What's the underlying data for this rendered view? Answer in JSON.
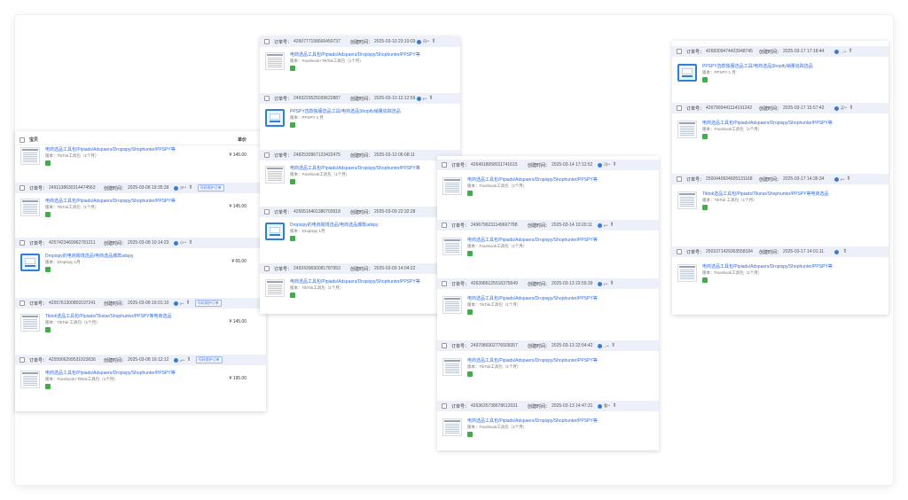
{
  "labels": {
    "order_no": "订单号：",
    "created": "创建时间：",
    "product_col": "宝贝",
    "price_col": "单价",
    "protect_badge": "号码保护订单"
  },
  "panel1": {
    "first_item": {
      "name": "电商选品工具包/Pipiads/Adspaers/Dropispy/Shophunter/PPSPY等",
      "spec": "版本：TikTok工具包（1个月）",
      "price": "¥ 145.00"
    },
    "orders": [
      {
        "id": "2491138630314474563",
        "time": "2025-03-08 19:35:39",
        "user": "沙**",
        "badge": true,
        "name": "电商选品工具包/Pipiads/Adspaers/Dropispy/Shophunter/PPSPY等",
        "spec": "版本：TikTok工具包（1个月）",
        "price": "¥ 145.00",
        "thumb": "doc"
      },
      {
        "id": "4257423469962781211",
        "time": "2025-03-08 10:14:23",
        "user": "小**",
        "badge": false,
        "name": "Dropispy的电商跨境选品/电商选品爆款adspy",
        "spec": "版本：Dropispy 1月",
        "price": "¥ 65.00",
        "thumb": "blue"
      },
      {
        "id": "4255761300803197241",
        "time": "2025-03-08 16:01:10",
        "user": "t**",
        "badge": true,
        "name": "Tiktok选品工具包/Pipiads/Tikstar/Shophunter/PPSPY等电商选品",
        "spec": "版本：TikTok 工具包（1个月）",
        "price": "¥ 145.00",
        "thumb": "doc"
      },
      {
        "id": "4255906299531923636",
        "time": "2025-03-08 16:12:12",
        "user": "v**",
        "badge": true,
        "name": "电商选品工具包/Pipiads/Adspaers/Dropispy/Shophunter/PPSPY等",
        "spec": "版本：Facebook+Tiktok工具包（1个月）",
        "price": "¥ 195.00",
        "thumb": "doc"
      }
    ]
  },
  "panel2": {
    "orders": [
      {
        "id": "4260777158666450737",
        "time": "2025-03-10 23:19:03",
        "user": "司**",
        "name": "电商选品工具包/Pipiads/Adspaers/Dropispy/Shophunter/PPSPY等",
        "spec": "版本：Facebook+TikTok工具包（1个月）",
        "thumb": "doc"
      },
      {
        "id": "2493229525039622887",
        "time": "2025-03-10 12:12:59",
        "user": "t**",
        "name": "PPSPY选款独服选品工具/电商选品Shopify销量追踪选品",
        "spec": "版本：PPSPY 1 月",
        "thumb": "blue"
      },
      {
        "id": "2482530967123422475",
        "time": "2025-03-10 06:08:11",
        "user": "",
        "name": "电商选品工具包/Pipiads/Adspaers/Dropispy/Shophunter/PPSPY等",
        "spec": "版本：Facebook工具包（1个月）",
        "thumb": "doc"
      },
      {
        "id": "4256516401380703918",
        "time": "2025-03-09 22:32:28",
        "user": "",
        "name": "Dropispy的电商跨境选品/电商选品爆款adspy",
        "spec": "版本：Dropispy 1月",
        "thumb": "blue"
      },
      {
        "id": "2492439690081787953",
        "time": "2025-03-09 14:04:22",
        "user": "",
        "name": "电商选品工具包/Pipiads/Adspaers/Dropispy/Shophunter/PPSPY等",
        "spec": "版本：TikTok工具包（1个月）",
        "thumb": "doc"
      }
    ]
  },
  "panel3": {
    "orders": [
      {
        "id": "4264918058011741615",
        "time": "2025-03-14 17:12:52",
        "user": "司**",
        "name": "电商选品工具包/Pipiads/Adspaers/Dropispy/Shophunter/PPSPY等",
        "spec": "版本：Facebook工具包（1个月）"
      },
      {
        "id": "2496796231149667788",
        "time": "2025-03-14 10:20:11",
        "user": "t**",
        "name": "电商选品工具包/Pipiads/Adspaers/Dropispy/Shophunter/PPSPY等",
        "spec": "版本：Facebook工具包（1个月）"
      },
      {
        "id": "4263986125516375649",
        "time": "2025-03-13 22:55:39",
        "user": "t**",
        "name": "电商选品工具包/Pipiads/Adspaers/Dropispy/Shophunter/PPSPY等",
        "spec": "版本：TikTok工具包（1个月）"
      },
      {
        "id": "2497086302776928357",
        "time": "2025-03-13 22:54:42",
        "user": "--**",
        "name": "电商选品工具包/Pipiads/Adspaers/Dropispy/Shophunter/PPSPY等",
        "spec": "版本：TikTok工具包（1个月）"
      },
      {
        "id": "4263635738678612031",
        "time": "2025-03-13 14:47:31",
        "user": "看**",
        "name": "电商选品工具包/Pipiads/Adspaers/Dropispy/Shophunter/PPSPY等",
        "spec": "版本：Facebook工具包（1个月）"
      }
    ]
  },
  "panel4": {
    "orders": [
      {
        "id": "4268309474423948745",
        "time": "2025-03-17 17:18:44",
        "user": "...**",
        "name": "PPSPY选款独服选品工具/电商选品Shopify销量追踪选品",
        "spec": "版本：PPSPY 1 月",
        "thumb": "blue"
      },
      {
        "id": "4267999441114191242",
        "time": "2025-03-17 15:57:43",
        "user": "买**",
        "name": "电商选品工具包/Pipiads/Adspaers/Dropispy/Shophunter/PPSPY等",
        "spec": "版本：Facebook工具包（1个月）",
        "thumb": "doc"
      },
      {
        "id": "2500440924605131168",
        "time": "2025-03-17 14:36:34",
        "user": "t**",
        "name": "Tiktok选品工具包/Pipiads/Tikstar/Shophunter/PPSPY等电商选品",
        "spec": "版本：TikTok 工具包（1个月）",
        "thumb": "doc"
      },
      {
        "id": "2501071429363558184",
        "time": "2025-03-17 14:01:11",
        "user": "",
        "name": "电商选品工具包/Pipiads/Adspaers/Dropispy/Shophunter/PPSPY等",
        "spec": "版本：Facebook工具包（1个月）",
        "thumb": "doc"
      }
    ]
  },
  "colors": {
    "accent": "#2d6ae0",
    "header_bg": "#edf0f8",
    "tag_green": "#3fae4a"
  },
  "icons": {
    "avatar": "user-avatar-icon",
    "filter": "filter-icon",
    "more": "more-icon"
  }
}
